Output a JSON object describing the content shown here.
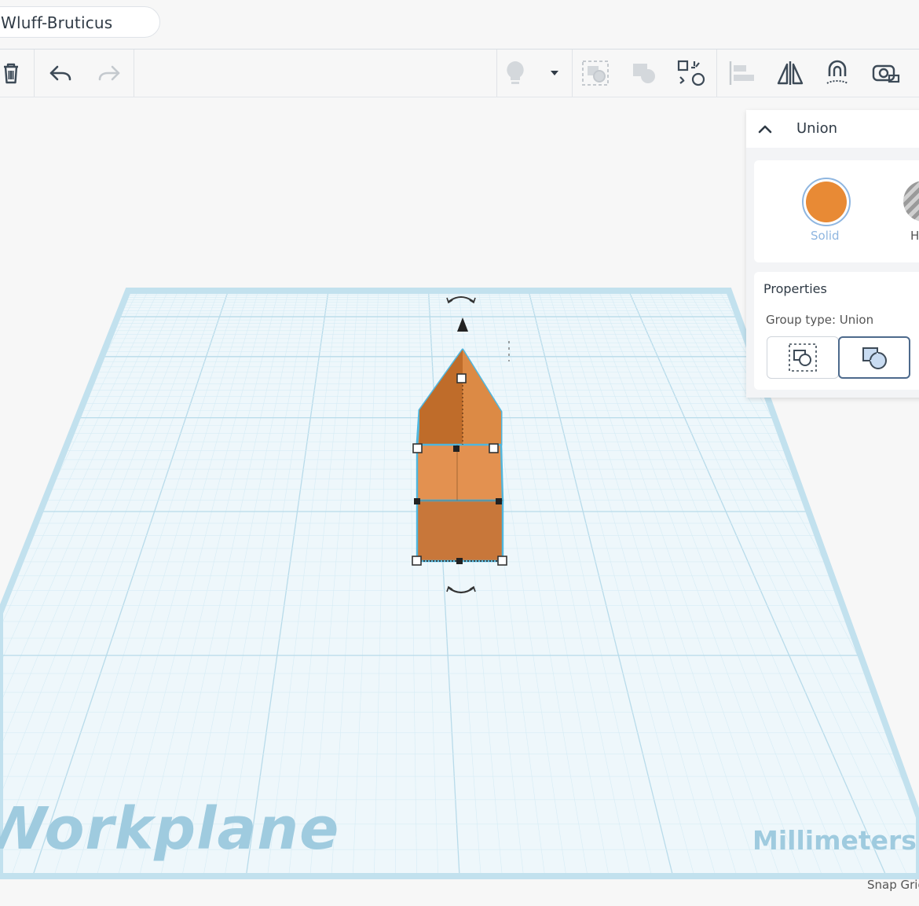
{
  "header": {
    "design_name": "Wluff-Bruticus"
  },
  "toolbar": {
    "left_tools": [
      "delete-icon",
      "undo-icon",
      "redo-icon"
    ],
    "right_tools": [
      "light-bulb-icon",
      "dropdown-icon",
      "group-icon",
      "ungroup-icon",
      "workplane-icon",
      "align-icon",
      "mirror-icon",
      "cruise-icon",
      "ruler-icon"
    ]
  },
  "inspector": {
    "title": "Union",
    "solid_label": "Solid",
    "hole_label": "H",
    "solid_color": "#e88a35",
    "properties_title": "Properties",
    "group_type": "Group type: Union",
    "group_type_options": [
      "separate-shapes-icon",
      "union-shapes-icon"
    ]
  },
  "workplane": {
    "label": "Workplane",
    "units": "Millimeters",
    "snap": "Snap Grid",
    "grid_color": "#d6ecf5",
    "shape_color": "#e0914a"
  }
}
